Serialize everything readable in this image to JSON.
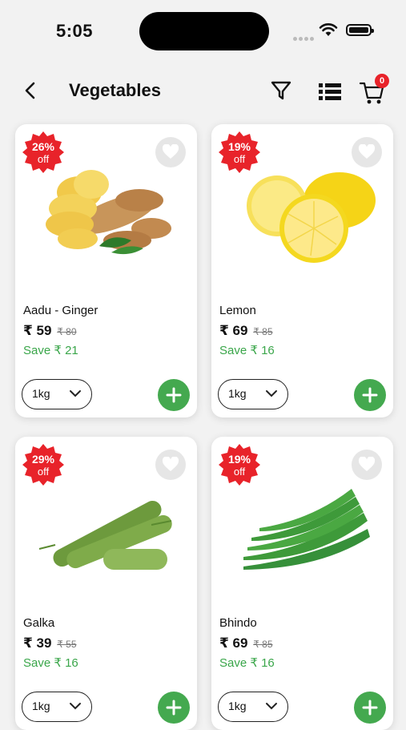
{
  "status_bar": {
    "time": "5:05"
  },
  "header": {
    "title": "Vegetables",
    "cart_count": "0"
  },
  "products": [
    {
      "name": "Aadu - Ginger",
      "price": "₹ 59",
      "mrp": "₹ 80",
      "save": "Save ₹ 21",
      "discount_pct": "26%",
      "off": "off",
      "qty": "1kg"
    },
    {
      "name": "Lemon",
      "price": "₹ 69",
      "mrp": "₹ 85",
      "save": "Save ₹ 16",
      "discount_pct": "19%",
      "off": "off",
      "qty": "1kg"
    },
    {
      "name": "Galka",
      "price": "₹ 39",
      "mrp": "₹ 55",
      "save": "Save ₹ 16",
      "discount_pct": "29%",
      "off": "off",
      "qty": "1kg"
    },
    {
      "name": "Bhindo",
      "price": "₹ 69",
      "mrp": "₹ 85",
      "save": "Save ₹ 16",
      "discount_pct": "19%",
      "off": "off",
      "qty": "1kg"
    }
  ],
  "colors": {
    "accent_green": "#44a94f",
    "badge_red": "#e8232a",
    "save_green": "#3aa64a"
  },
  "icons": [
    "back-arrow-icon",
    "filter-icon",
    "list-view-icon",
    "cart-icon",
    "heart-icon",
    "chevron-down-icon",
    "plus-icon"
  ]
}
